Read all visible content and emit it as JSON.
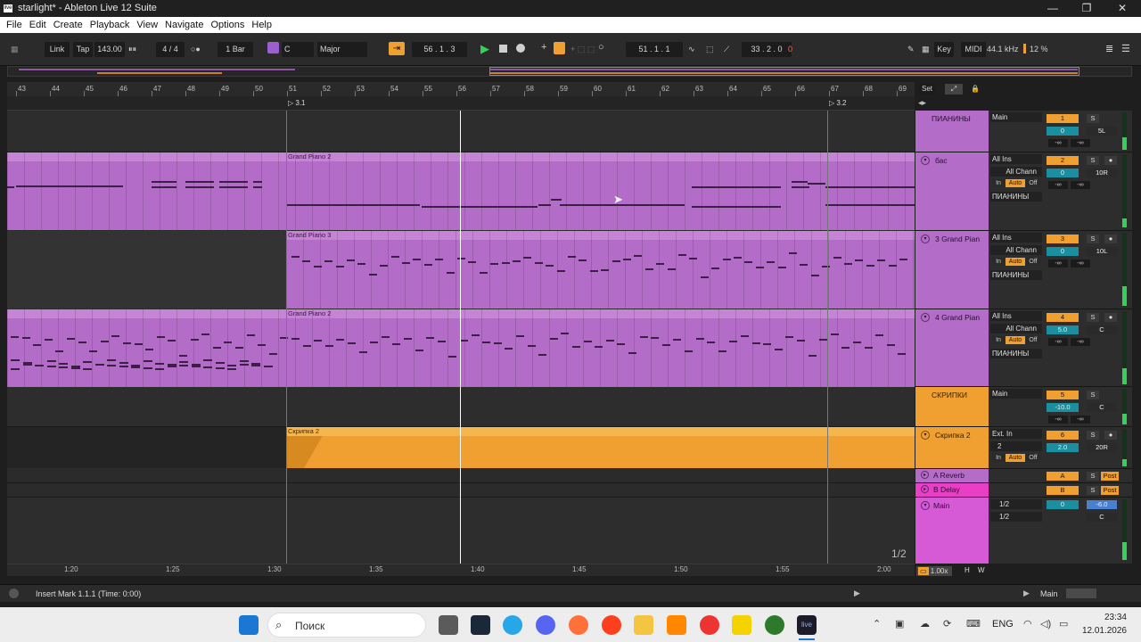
{
  "window": {
    "title": "starlight* - Ableton Live 12 Suite",
    "app_icon": "live",
    "min": "—",
    "max": "❐",
    "close": "✕"
  },
  "menu": [
    "File",
    "Edit",
    "Create",
    "Playback",
    "View",
    "Navigate",
    "Options",
    "Help"
  ],
  "transport": {
    "link": "Link",
    "tap": "Tap",
    "tempo": "143.00",
    "sig": "4 / 4",
    "quant": "1 Bar",
    "key_root": "C",
    "scale": "Major",
    "position": "56 .  1 .  3",
    "loop_start": "51 .  1 .  1",
    "loop_len": "33 .  2 .  0",
    "key": "Key",
    "midi": "MIDI",
    "sample_rate": "44.1 kHz",
    "cpu": "12 %"
  },
  "ruler": {
    "bars": [
      "43",
      "44",
      "45",
      "46",
      "47",
      "48",
      "49",
      "50",
      "51",
      "52",
      "53",
      "54",
      "55",
      "56",
      "57",
      "58",
      "59",
      "60",
      "61",
      "62",
      "63",
      "64",
      "65",
      "66",
      "67",
      "68",
      "69"
    ],
    "set": "Set"
  },
  "locators": [
    "3.1",
    "3.2"
  ],
  "clips": {
    "bass": "Grand Piano 2",
    "piano3": "Grand Piano 3",
    "piano4": "Grand Piano 2",
    "violin": "Скрипка 2"
  },
  "tracks": [
    {
      "name": "ПИАНИНЫ",
      "io1": "Main",
      "num": "1",
      "vol": "0",
      "pan": "5L",
      "inf1": "-∞",
      "inf2": "-∞"
    },
    {
      "name": "бас",
      "io1": "All Ins",
      "io2": "All Chann",
      "io3": "ПИАНИНЫ",
      "num": "2",
      "vol": "0",
      "pan": "10R",
      "inf1": "-∞",
      "inf2": "-∞",
      "in": "In",
      "auto": "Auto",
      "off": "Off"
    },
    {
      "name": "3 Grand Pian",
      "io1": "All Ins",
      "io2": "All Chann",
      "io3": "ПИАНИНЫ",
      "num": "3",
      "vol": "0",
      "pan": "10L",
      "inf1": "-∞",
      "inf2": "-∞",
      "in": "In",
      "auto": "Auto",
      "off": "Off"
    },
    {
      "name": "4 Grand Pian",
      "io1": "All Ins",
      "io2": "All Chann",
      "io3": "ПИАНИНЫ",
      "num": "4",
      "vol": "5.0",
      "pan": "C",
      "inf1": "-∞",
      "inf2": "-∞",
      "in": "In",
      "auto": "Auto",
      "off": "Off"
    },
    {
      "name": "СКРИПКИ",
      "io1": "Main",
      "num": "5",
      "vol": "-10.0",
      "pan": "C",
      "inf1": "-∞",
      "inf2": "-∞"
    },
    {
      "name": "Скрипка 2",
      "io1": "Ext. In",
      "io2": "2",
      "num": "6",
      "vol": "2.0",
      "pan": "20R",
      "in": "In",
      "auto": "Auto",
      "off": "Off"
    },
    {
      "name": "A Reverb",
      "num": "A",
      "post": "Post"
    },
    {
      "name": "B Delay",
      "num": "B",
      "post": "Post"
    },
    {
      "name": "Main",
      "io1": "1/2",
      "io2": "1/2",
      "vol": "0",
      "pan": "-6.0",
      "pan2": "C"
    }
  ],
  "solo": "S",
  "page": "1/2",
  "zoom": "1.00x",
  "hw": [
    "H",
    "W"
  ],
  "timeline": [
    "1:20",
    "1:25",
    "1:30",
    "1:35",
    "1:40",
    "1:45",
    "1:50",
    "1:55",
    "2:00"
  ],
  "status": {
    "text": "Insert Mark 1.1.1 (Time: 0:00)",
    "main": "Main"
  },
  "taskbar": {
    "search": "Поиск",
    "lang": "ENG",
    "time": "23:34",
    "date": "12.01.2026",
    "live": "live"
  },
  "colors": {
    "purple": "#b36cc7",
    "orange": "#f0a030",
    "cyan": "#1a8fa0"
  }
}
